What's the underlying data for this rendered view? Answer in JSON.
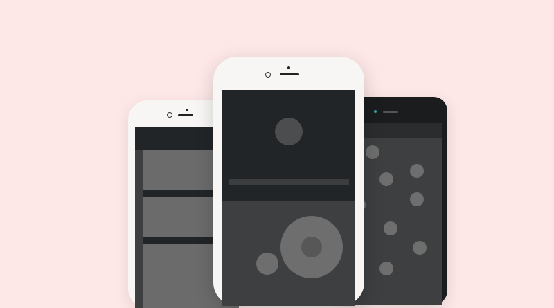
{
  "scene": {
    "background_color": "#fde8e7",
    "phones": {
      "left": {
        "style": "white-iphone",
        "screen": "list-wireframe"
      },
      "center": {
        "style": "white-iphone",
        "screen": "media-player-wireframe"
      },
      "right": {
        "style": "black-android",
        "screen": "dots-grid-wireframe"
      }
    },
    "colors": {
      "white_phone_body": "#f7f6f5",
      "black_phone_body": "#1b1c1e",
      "dark_bar": "#222528",
      "screen_gray": "#3d3f40",
      "mid_gray": "#6b6b6b"
    }
  }
}
